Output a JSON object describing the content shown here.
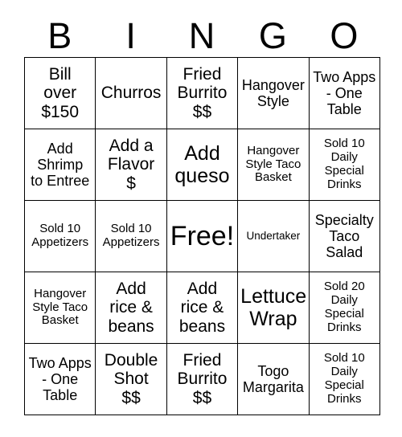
{
  "card": {
    "title": "BINGO",
    "header": {
      "letters": [
        "B",
        "I",
        "N",
        "G",
        "O"
      ]
    },
    "free_space": {
      "label": "Free!",
      "row": 2,
      "col": 2
    },
    "grid": {
      "rows": 5,
      "cols": 5,
      "cells": [
        [
          {
            "text": "Bill\nover\n$150",
            "size": "lg",
            "free": false
          },
          {
            "text": "Churros",
            "size": "lg",
            "free": false
          },
          {
            "text": "Fried\nBurrito\n$$",
            "size": "lg",
            "free": false
          },
          {
            "text": "Hangover\nStyle",
            "size": "md",
            "free": false
          },
          {
            "text": "Two Apps\n- One\nTable",
            "size": "md",
            "free": false
          }
        ],
        [
          {
            "text": "Add\nShrimp\nto Entree",
            "size": "md",
            "free": false
          },
          {
            "text": "Add a\nFlavor\n$",
            "size": "lg",
            "free": false
          },
          {
            "text": "Add\nqueso",
            "size": "xl",
            "free": false
          },
          {
            "text": "Hangover\nStyle Taco\nBasket",
            "size": "sm",
            "free": false
          },
          {
            "text": "Sold 10\nDaily\nSpecial\nDrinks",
            "size": "sm",
            "free": false
          }
        ],
        [
          {
            "text": "Sold 10\nAppetizers",
            "size": "sm",
            "free": false
          },
          {
            "text": "Sold 10\nAppetizers",
            "size": "sm",
            "free": false
          },
          {
            "text": "Free!",
            "size": "xxl",
            "free": true
          },
          {
            "text": "Undertaker",
            "size": "xs",
            "free": false
          },
          {
            "text": "Specialty\nTaco\nSalad",
            "size": "md",
            "free": false
          }
        ],
        [
          {
            "text": "Hangover\nStyle Taco\nBasket",
            "size": "sm",
            "free": false
          },
          {
            "text": "Add\nrice &\nbeans",
            "size": "lg",
            "free": false
          },
          {
            "text": "Add\nrice &\nbeans",
            "size": "lg",
            "free": false
          },
          {
            "text": "Lettuce\nWrap",
            "size": "xl",
            "free": false
          },
          {
            "text": "Sold 20\nDaily\nSpecial\nDrinks",
            "size": "sm",
            "free": false
          }
        ],
        [
          {
            "text": "Two Apps\n- One\nTable",
            "size": "md",
            "free": false
          },
          {
            "text": "Double\nShot\n$$",
            "size": "lg",
            "free": false
          },
          {
            "text": "Fried\nBurrito\n$$",
            "size": "lg",
            "free": false
          },
          {
            "text": "Togo\nMargarita",
            "size": "md",
            "free": false
          },
          {
            "text": "Sold 10\nDaily\nSpecial\nDrinks",
            "size": "sm",
            "free": false
          }
        ]
      ]
    },
    "colors": {
      "background": "#ffffff",
      "text": "#000000",
      "border": "#000000"
    }
  }
}
